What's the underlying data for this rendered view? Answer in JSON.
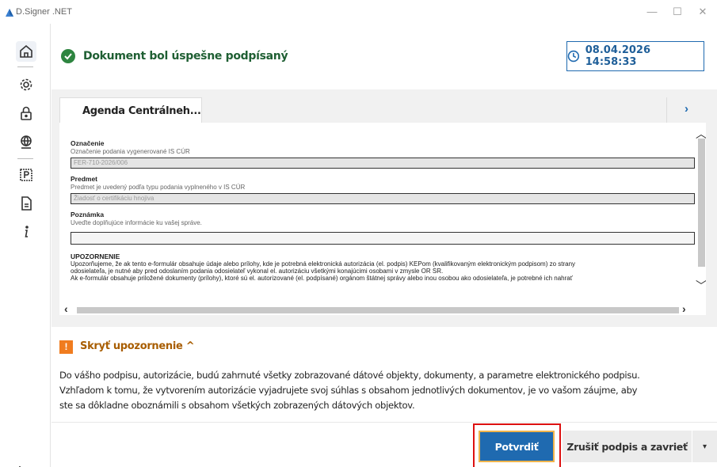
{
  "window": {
    "title": "D.Signer .NET",
    "minimize": "—",
    "maximize": "☐",
    "close": "✕"
  },
  "sidebar": {
    "items": [
      {
        "name": "home-icon"
      },
      {
        "name": "gear-icon"
      },
      {
        "name": "lock-icon"
      },
      {
        "name": "globe-icon"
      },
      {
        "name": "parking-icon"
      },
      {
        "name": "document-icon"
      },
      {
        "name": "info-icon"
      }
    ],
    "exit": "exit-icon"
  },
  "status": {
    "message": "Dokument bol úspešne podpísaný",
    "datetime": "08.04.2026 14:58:33"
  },
  "tab": {
    "label": "Agenda Centrálneh...",
    "next": "›"
  },
  "form": {
    "fields": [
      {
        "label": "Označenie",
        "hint": "Označenie podania vygenerované IS CÚR",
        "value": "FER-710-2026/006"
      },
      {
        "label": "Predmet",
        "hint": "Predmet je uvedený podľa typu podania vyplneného v IS CÚR",
        "value": "Žiadosť o certifikáciu hnojiva"
      },
      {
        "label": "Poznámka",
        "hint": "Uveďte doplňujúce informácie ku vašej správe.",
        "value": ""
      }
    ],
    "warning_title": "UPOZORNENIE",
    "warning_line1": "Upozorňujeme, že ak tento e-formulár obsahuje údaje alebo prílohy, kde je potrebná elektronická autorizácia (el. podpis) KEPom (kvalifikovaným elektronickým podpisom) zo strany",
    "warning_line2": "odosielateľa, je nutné aby pred odoslaním podania odosielateľ vykonal el. autorizáciu všetkými konajúcimi osobami v zmysle OR SR.",
    "warning_line3": "Ak e-formulár obsahuje priložené dokumenty (prílohy), ktoré sú el. autorizované (el. podpísané) orgánom štátnej správy alebo inou osobou ako odosielateľa, je potrebné ich nahrať"
  },
  "notice": {
    "toggle": "Skryť upozornenie ^",
    "line1": "Do vášho podpisu, autorizácie, budú zahrnuté všetky zobrazované dátové objekty, dokumenty, a parametre elektronického podpisu.",
    "line2": "Vzhľadom k tomu, že vytvorením autorizácie vyjadrujete svoj súhlas s obsahom jednotlivých dokumentov, je vo vašom záujme, aby",
    "line3": "ste sa dôkladne oboznámili s obsahom všetkých zobrazených dátových objektov."
  },
  "buttons": {
    "confirm": "Potvrdiť",
    "cancel": "Zrušiť podpis a zavrieť",
    "dropdown": "▾"
  },
  "colors": {
    "accent": "#1f6ab0",
    "success": "#2e8540",
    "warning": "#f07c1f",
    "highlight": "#dd1111"
  }
}
